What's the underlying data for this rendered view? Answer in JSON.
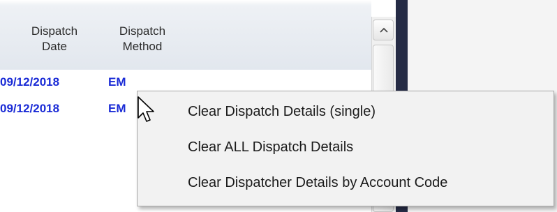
{
  "grid": {
    "columns": [
      {
        "line1": "Dispatch",
        "line2": "Date"
      },
      {
        "line1": "Dispatch",
        "line2": "Method"
      }
    ],
    "rows": [
      {
        "date": "09/12/2018",
        "method": "EM"
      },
      {
        "date": "09/12/2018",
        "method": "EM"
      }
    ]
  },
  "context_menu": {
    "items": [
      "Clear Dispatch Details (single)",
      "Clear ALL Dispatch Details",
      "Clear Dispatcher Details by Account Code"
    ]
  },
  "icons": {
    "scroll_up": "chevron-up-icon",
    "cursor": "mouse-pointer-icon"
  },
  "colors": {
    "row_text": "#1a2bd6",
    "splitter": "#252b45",
    "menu_background": "#f2f2f2"
  }
}
